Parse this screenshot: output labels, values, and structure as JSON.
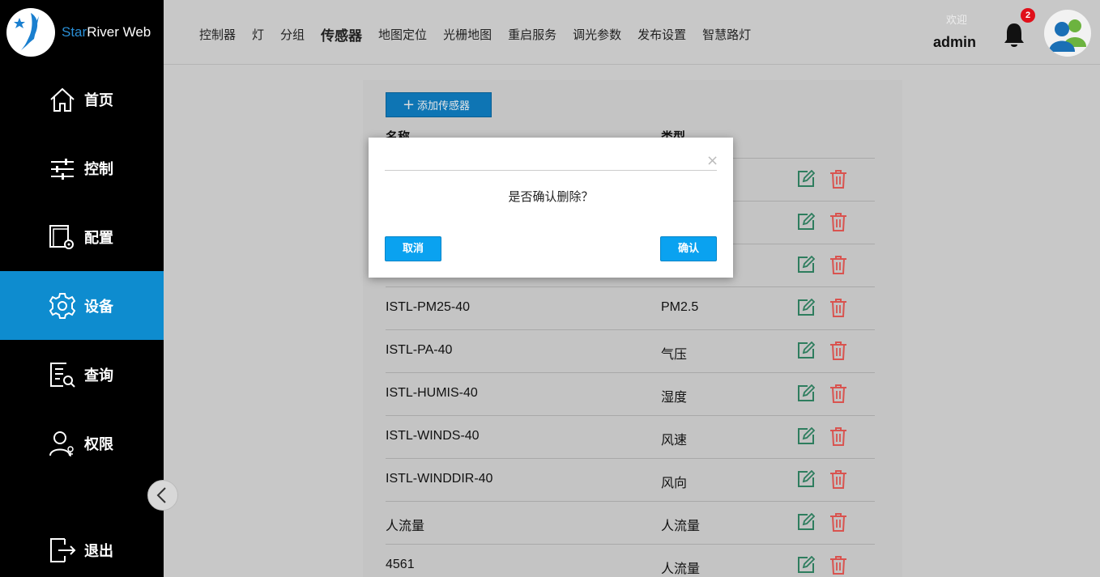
{
  "app": {
    "brand_part1": "Star",
    "brand_part2": "River Web"
  },
  "sidebar": {
    "items": [
      {
        "label": "首页",
        "icon": "home-icon"
      },
      {
        "label": "控制",
        "icon": "sliders-icon"
      },
      {
        "label": "配置",
        "icon": "config-icon"
      },
      {
        "label": "设备",
        "icon": "gear-icon",
        "active": true
      },
      {
        "label": "查询",
        "icon": "search-doc-icon"
      },
      {
        "label": "权限",
        "icon": "user-key-icon"
      }
    ],
    "logout": "退出"
  },
  "topnav": {
    "items": [
      "控制器",
      "灯",
      "分组",
      "传感器",
      "地图定位",
      "光栅地图",
      "重启服务",
      "调光参数",
      "发布设置",
      "智慧路灯"
    ],
    "active_index": 3
  },
  "header": {
    "welcome": "欢迎",
    "username": "admin",
    "notification_count": "2"
  },
  "main": {
    "add_button": "添加传感器",
    "columns": [
      "名称",
      "类型"
    ],
    "rows": [
      {
        "name": "",
        "type": ""
      },
      {
        "name": "",
        "type": ""
      },
      {
        "name": "",
        "type": ""
      },
      {
        "name": "ISTL-PM25-40",
        "type": "PM2.5"
      },
      {
        "name": "ISTL-PA-40",
        "type": "气压"
      },
      {
        "name": "ISTL-HUMIS-40",
        "type": "湿度"
      },
      {
        "name": "ISTL-WINDS-40",
        "type": "风速"
      },
      {
        "name": "ISTL-WINDDIR-40",
        "type": "风向"
      },
      {
        "name": "人流量",
        "type": "人流量"
      },
      {
        "name": "4561",
        "type": "人流量"
      }
    ]
  },
  "modal": {
    "close": "×",
    "message": "是否确认删除？",
    "cancel": "取消",
    "confirm": "确认"
  },
  "colors": {
    "accent": "#0e8ccf",
    "modal_button": "#0aa2f0",
    "edit": "#2e7d5e",
    "delete": "#d9534f"
  }
}
